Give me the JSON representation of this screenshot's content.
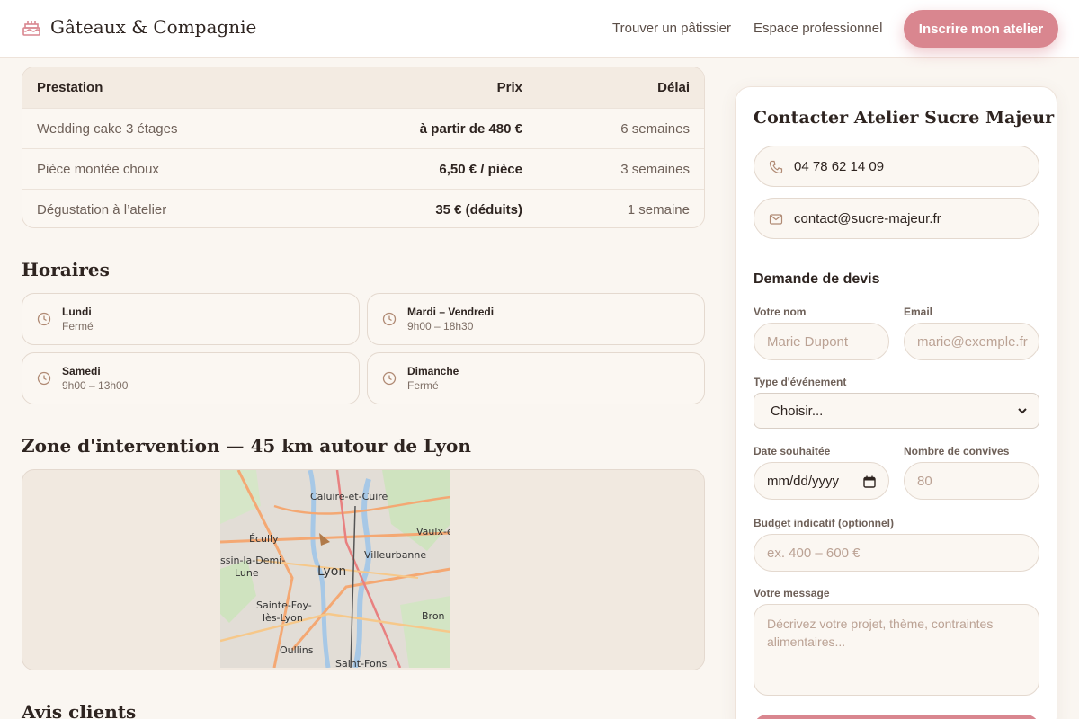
{
  "header": {
    "brand": "Gâteaux & Compagnie",
    "nav": [
      "Trouver un pâtissier",
      "Espace professionnel"
    ],
    "cta": "Inscrire mon atelier"
  },
  "pricing": {
    "columns": [
      "Prestation",
      "Prix",
      "Délai"
    ],
    "rows": [
      {
        "service": "Wedding cake 3 étages",
        "price": "à partir de 480 €",
        "delay": "6 semaines"
      },
      {
        "service": "Pièce montée choux",
        "price": "6,50 € / pièce",
        "delay": "3 semaines"
      },
      {
        "service": "Dégustation à l’atelier",
        "price": "35 € (déduits)",
        "delay": "1 semaine"
      }
    ]
  },
  "hours": {
    "title": "Horaires",
    "items": [
      {
        "day": "Lundi",
        "time": "Fermé"
      },
      {
        "day": "Mardi – Vendredi",
        "time": "9h00 – 18h30"
      },
      {
        "day": "Samedi",
        "time": "9h00 – 13h00"
      },
      {
        "day": "Dimanche",
        "time": "Fermé"
      }
    ]
  },
  "zone": {
    "title": "Zone d'intervention — 45 km autour de Lyon",
    "labels": [
      "Caluire-et-Cuire",
      "Écully",
      "Vaulx-e",
      "ssin-la-Demi-",
      "Lune",
      "Villeurbanne",
      "Lyon",
      "Sainte-Foy-",
      "lès-Lyon",
      "Bron",
      "Oullins",
      "Saint-Fons"
    ]
  },
  "reviews": {
    "title": "Avis clients"
  },
  "contact": {
    "title": "Contacter Atelier Sucre Majeur",
    "phone": "04 78 62 14 09",
    "email": "contact@sucre-majeur.fr"
  },
  "form": {
    "title": "Demande de devis",
    "name_label": "Votre nom",
    "name_placeholder": "Marie Dupont",
    "email_label": "Email",
    "email_placeholder": "marie@exemple.fr",
    "event_label": "Type d'événement",
    "event_value": "Choisir...",
    "date_label": "Date souhaitée",
    "date_value": "mm/dd/yyyy",
    "guests_label": "Nombre de convives",
    "guests_placeholder": "80",
    "budget_label": "Budget indicatif (optionnel)",
    "budget_placeholder": "ex. 400 – 600 €",
    "message_label": "Votre message",
    "message_placeholder": "Décrivez votre projet, thème, contraintes alimentaires..."
  },
  "colors": {
    "accent": "#d9868f",
    "background": "#faf6f1",
    "icon": "#b08a74"
  }
}
